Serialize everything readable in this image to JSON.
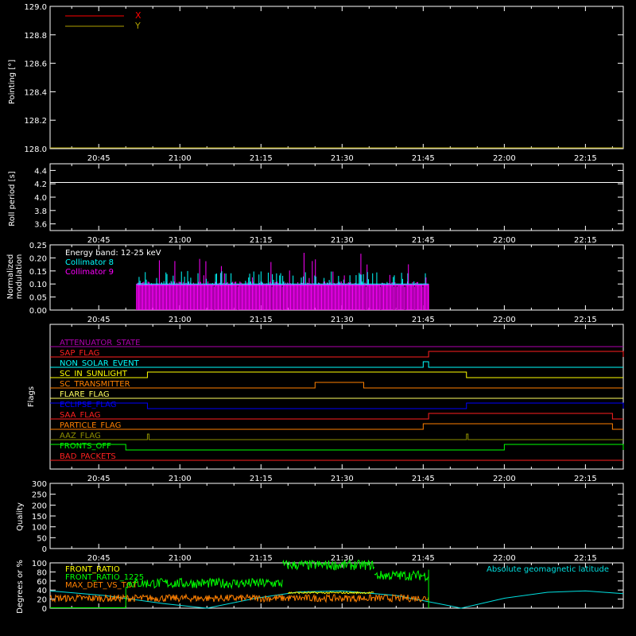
{
  "chart_data": [
    {
      "type": "line",
      "ylabel": "Pointing [°]",
      "ylim": [
        128.0,
        129.0
      ],
      "yticks": [
        128.0,
        128.2,
        128.4,
        128.6,
        128.8,
        129.0
      ],
      "ytick_labels": [
        "128.0",
        "128.2",
        "128.4",
        "128.6",
        "128.8",
        "129.0"
      ],
      "xlim": [
        "20:36",
        "22:22"
      ],
      "xtick_labels": [
        "20:45",
        "21:00",
        "21:15",
        "21:30",
        "21:45",
        "22:00",
        "22:15"
      ],
      "legend_position": "top-left",
      "series": [
        {
          "name": "X",
          "color": "#ff0000",
          "flat_value": 128.0
        },
        {
          "name": "Y",
          "color": "#b0a000",
          "flat_value": 128.0
        }
      ]
    },
    {
      "type": "line",
      "ylabel": "Roll period [s]",
      "ylim": [
        3.5,
        4.5
      ],
      "yticks": [
        3.6,
        3.8,
        4.0,
        4.2,
        4.4
      ],
      "ytick_labels": [
        "3.6",
        "3.8",
        "4.0",
        "4.2",
        "4.4"
      ],
      "xtick_labels": [
        "20:45",
        "21:00",
        "21:15",
        "21:30",
        "21:45",
        "22:00",
        "22:15"
      ],
      "series": [
        {
          "color": "#ffffff",
          "flat_value": 4.22
        }
      ]
    },
    {
      "type": "line",
      "ylabel": "Normalized modulation",
      "ylim": [
        0.0,
        0.25
      ],
      "yticks": [
        0.0,
        0.05,
        0.1,
        0.15,
        0.2,
        0.25
      ],
      "ytick_labels": [
        "0.00",
        "0.05",
        "0.10",
        "0.15",
        "0.20",
        "0.25"
      ],
      "xtick_labels": [
        "20:45",
        "21:00",
        "21:15",
        "21:30",
        "21:45",
        "22:00",
        "22:15"
      ],
      "annotation": "Energy band: 12-25 keV",
      "legend_position": "top-left",
      "data_range": [
        "20:52",
        "21:46"
      ],
      "series": [
        {
          "name": "Collimator 8",
          "color": "#00ffff",
          "typical_value": 0.1
        },
        {
          "name": "Collimator 9",
          "color": "#ff00ff",
          "typical_value": 0.1
        }
      ]
    },
    {
      "type": "step",
      "ylabel": "Flags",
      "xtick_labels": [
        "20:45",
        "21:00",
        "21:15",
        "21:30",
        "21:45",
        "22:00",
        "22:15"
      ],
      "flags": [
        {
          "name": "ATTENUATOR_STATE",
          "color": "#b000b0",
          "on": []
        },
        {
          "name": "SAP_FLAG",
          "color": "#ff2020",
          "on": [
            [
              "21:46",
              "22:22"
            ]
          ]
        },
        {
          "name": "NON_SOLAR_EVENT",
          "color": "#00ffff",
          "on": [
            [
              "21:45",
              "21:46"
            ]
          ]
        },
        {
          "name": "SC_IN_SUNLIGHT",
          "color": "#ffff00",
          "on": [
            [
              "20:54",
              "21:53"
            ]
          ]
        },
        {
          "name": "SC_TRANSMITTER",
          "color": "#ff8000",
          "on": [
            [
              "21:25",
              "21:34"
            ]
          ]
        },
        {
          "name": "FLARE_FLAG",
          "color": "#ffff60",
          "on": []
        },
        {
          "name": "ECLIPSE_FLAG",
          "color": "#0000ff",
          "on": [
            [
              "20:36",
              "20:54"
            ],
            [
              "21:53",
              "22:22"
            ]
          ]
        },
        {
          "name": "SAA_FLAG",
          "color": "#ff2020",
          "on": [
            [
              "21:46",
              "22:20"
            ]
          ]
        },
        {
          "name": "PARTICLE_FLAG",
          "color": "#ff8000",
          "on": [
            [
              "21:45",
              "22:20"
            ]
          ]
        },
        {
          "name": "AAZ_FLAG",
          "color": "#909000",
          "on": [
            [
              "20:54",
              "20:54"
            ],
            [
              "21:53",
              "21:53"
            ]
          ]
        },
        {
          "name": "FRONTS_OFF",
          "color": "#00ff00",
          "on": [
            [
              "20:36",
              "20:50"
            ],
            [
              "22:00",
              "22:22"
            ]
          ]
        },
        {
          "name": "BAD_PACKETS",
          "color": "#ff2020",
          "on": []
        }
      ]
    },
    {
      "type": "line",
      "ylabel": "Quality",
      "ylim": [
        0,
        300
      ],
      "yticks": [
        0,
        50,
        100,
        150,
        200,
        250,
        300
      ],
      "ytick_labels": [
        "0",
        "50",
        "100",
        "150",
        "200",
        "250",
        "300"
      ],
      "xtick_labels": [
        "20:45",
        "21:00",
        "21:15",
        "21:30",
        "21:45",
        "22:00",
        "22:15"
      ],
      "series": []
    },
    {
      "type": "line",
      "ylabel": "Degrees or %",
      "ylim": [
        0,
        100
      ],
      "yticks": [
        0,
        20,
        40,
        60,
        80,
        100
      ],
      "ytick_labels": [
        "0",
        "20",
        "40",
        "60",
        "80",
        "100"
      ],
      "annotation": "Absolute geomagnetic latitude",
      "series": [
        {
          "name": "FRONT_RATIO",
          "color": "#ffff00",
          "segments": [
            [
              "21:20",
              "21:36",
              34
            ]
          ]
        },
        {
          "name": "FRONT_RATIO_1225",
          "color": "#00ff00",
          "segments": [
            [
              "20:50",
              "21:19",
              55
            ],
            [
              "21:19",
              "21:36",
              95
            ],
            [
              "21:36",
              "21:46",
              72
            ]
          ]
        },
        {
          "name": "MAX_DET_VS_TOT",
          "color": "#ff8000",
          "segments": [
            [
              "20:36",
              "21:46",
              22
            ]
          ]
        },
        {
          "name": "Absolute geomagnetic latitude",
          "color": "#00e0e0",
          "points": [
            [
              "20:36",
              38
            ],
            [
              "20:46",
              28
            ],
            [
              "20:57",
              10
            ],
            [
              "21:05",
              0
            ],
            [
              "21:14",
              22
            ],
            [
              "21:22",
              36
            ],
            [
              "21:30",
              38
            ],
            [
              "21:40",
              28
            ],
            [
              "21:50",
              5
            ],
            [
              "21:52",
              0
            ],
            [
              "22:00",
              22
            ],
            [
              "22:08",
              35
            ],
            [
              "22:15",
              38
            ],
            [
              "22:22",
              32
            ]
          ]
        }
      ]
    }
  ]
}
